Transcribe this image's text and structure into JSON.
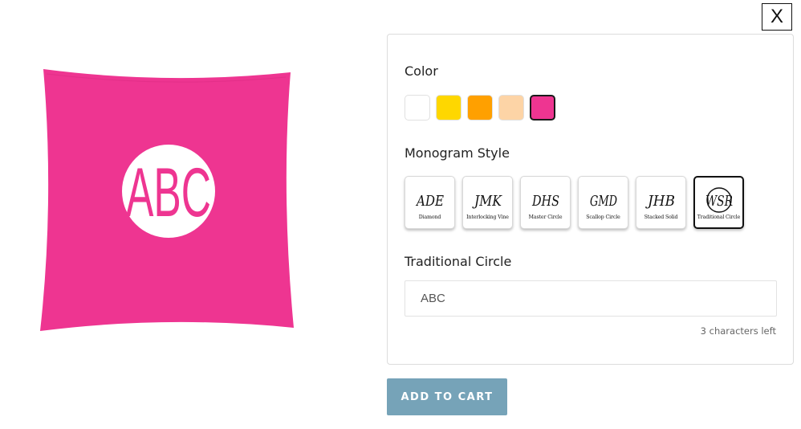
{
  "close_label": "X",
  "product": {
    "monogram": "ABC",
    "color": "#ee3591"
  },
  "panel": {
    "color_label": "Color",
    "colors": [
      {
        "name": "white",
        "hex": "#ffffff",
        "selected": false
      },
      {
        "name": "yellow",
        "hex": "#fed700",
        "selected": false
      },
      {
        "name": "orange",
        "hex": "#ffa000",
        "selected": false
      },
      {
        "name": "peach",
        "hex": "#fdd4a6",
        "selected": false
      },
      {
        "name": "pink",
        "hex": "#ee3591",
        "selected": true
      }
    ],
    "style_label": "Monogram Style",
    "styles": [
      {
        "glyph": "ADE",
        "caption": "Diamond",
        "selected": false
      },
      {
        "glyph": "JMK",
        "caption": "Interlocking Vine",
        "selected": false
      },
      {
        "glyph": "DHS",
        "caption": "Master Circle",
        "selected": false
      },
      {
        "glyph": "GMD",
        "caption": "Scallop Circle",
        "selected": false
      },
      {
        "glyph": "JHB",
        "caption": "Stacked Solid",
        "selected": false
      },
      {
        "glyph": "WSR",
        "caption": "Traditional Circle",
        "selected": true
      }
    ],
    "selected_style_label": "Traditional Circle",
    "input_value": "ABC",
    "chars_left": "3 characters left"
  },
  "add_to_cart_label": "ADD TO CART"
}
